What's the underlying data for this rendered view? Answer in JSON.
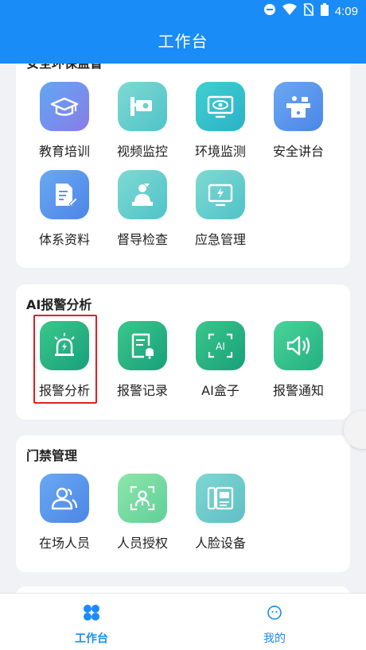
{
  "status": {
    "time": "4:09"
  },
  "app": {
    "title": "工作台"
  },
  "section1": {
    "title": "安全环保监督",
    "items": [
      {
        "label": "教育培训",
        "icon": "graduation-cap-icon"
      },
      {
        "label": "视频监控",
        "icon": "cctv-camera-icon"
      },
      {
        "label": "环境监测",
        "icon": "monitor-eye-icon"
      },
      {
        "label": "安全讲台",
        "icon": "podium-icon"
      },
      {
        "label": "体系资料",
        "icon": "document-pen-icon"
      },
      {
        "label": "督导检查",
        "icon": "inspector-icon"
      },
      {
        "label": "应急管理",
        "icon": "emergency-monitor-icon"
      }
    ]
  },
  "section2": {
    "title": "AI报警分析",
    "items": [
      {
        "label": "报警分析",
        "icon": "alarm-light-icon"
      },
      {
        "label": "报警记录",
        "icon": "alarm-record-icon"
      },
      {
        "label": "AI盒子",
        "icon": "ai-box-icon"
      },
      {
        "label": "报警通知",
        "icon": "speaker-icon"
      }
    ]
  },
  "section3": {
    "title": "门禁管理",
    "items": [
      {
        "label": "在场人员",
        "icon": "people-icon"
      },
      {
        "label": "人员授权",
        "icon": "face-scan-user-icon"
      },
      {
        "label": "人脸设备",
        "icon": "face-device-icon"
      }
    ]
  },
  "nav": {
    "items": [
      {
        "label": "工作台",
        "icon": "grid-icon",
        "active": true
      },
      {
        "label": "我的",
        "icon": "profile-icon",
        "active": false
      }
    ]
  },
  "colors": {
    "brand": "#1a8cf7",
    "highlight": "#e02020"
  }
}
